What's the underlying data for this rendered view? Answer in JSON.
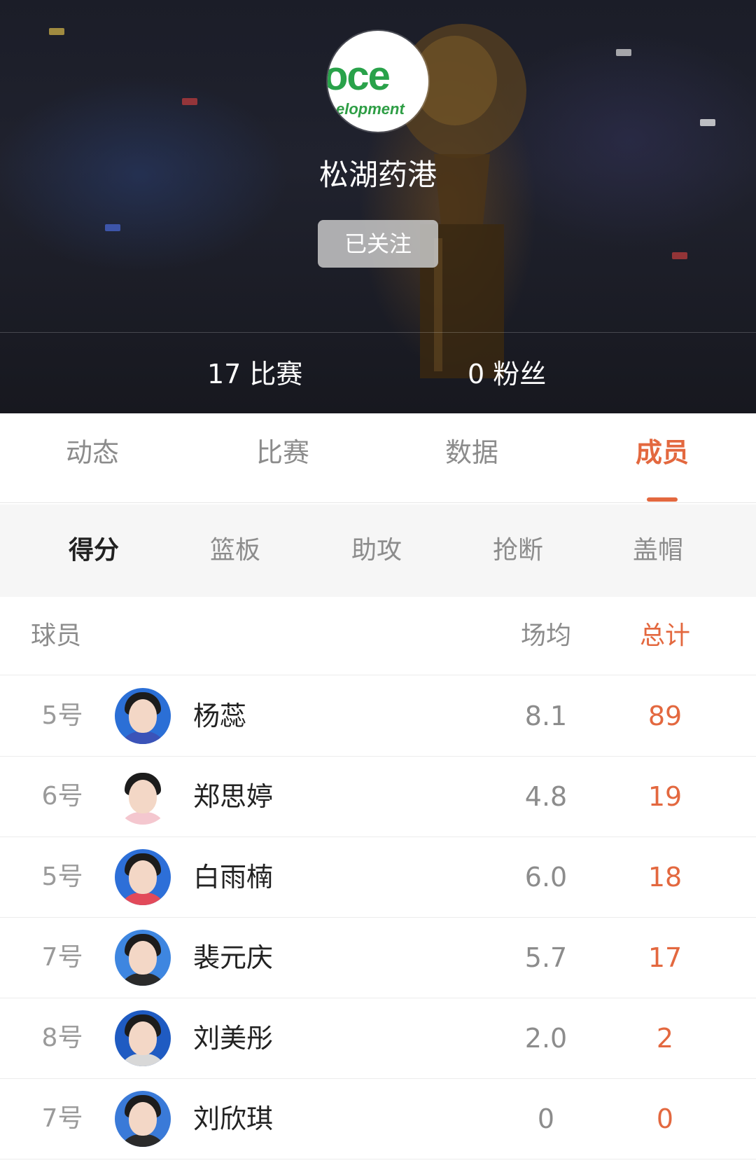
{
  "team": {
    "logo_text_main": "oce",
    "logo_text_sub": "elopment",
    "name": "松湖药港",
    "follow_label": "已关注"
  },
  "stats": {
    "games_count": "17",
    "games_label": "比赛",
    "fans_count": "0",
    "fans_label": "粉丝"
  },
  "tabs": [
    {
      "label": "动态",
      "active": false
    },
    {
      "label": "比赛",
      "active": false
    },
    {
      "label": "数据",
      "active": false
    },
    {
      "label": "成员",
      "active": true
    }
  ],
  "subtabs": [
    {
      "label": "得分",
      "active": true
    },
    {
      "label": "篮板",
      "active": false
    },
    {
      "label": "助攻",
      "active": false
    },
    {
      "label": "抢断",
      "active": false
    },
    {
      "label": "盖帽",
      "active": false
    }
  ],
  "table": {
    "headers": {
      "player": "球员",
      "avg": "场均",
      "total": "总计"
    },
    "rows": [
      {
        "number": "5号",
        "name": "杨蕊",
        "avg": "8.1",
        "total": "89",
        "avatar_bg": "#2b6fd6",
        "jersey": "#3b53b8"
      },
      {
        "number": "6号",
        "name": "郑思婷",
        "avg": "4.8",
        "total": "19",
        "avatar_bg": "#ffffff",
        "jersey": "#f4c7cf"
      },
      {
        "number": "5号",
        "name": "白雨楠",
        "avg": "6.0",
        "total": "18",
        "avatar_bg": "#2d6fd8",
        "jersey": "#e24a5a"
      },
      {
        "number": "7号",
        "name": "裴元庆",
        "avg": "5.7",
        "total": "17",
        "avatar_bg": "#3e86e0",
        "jersey": "#2a2a2a"
      },
      {
        "number": "8号",
        "name": "刘美彤",
        "avg": "2.0",
        "total": "2",
        "avatar_bg": "#1f5bc2",
        "jersey": "#d8d8d8"
      },
      {
        "number": "7号",
        "name": "刘欣琪",
        "avg": "0",
        "total": "0",
        "avatar_bg": "#3a7ad8",
        "jersey": "#2a2a2a"
      }
    ]
  },
  "colors": {
    "accent": "#e3683f",
    "muted": "#8c8c8c",
    "subtab_bg": "#f6f6f6"
  }
}
